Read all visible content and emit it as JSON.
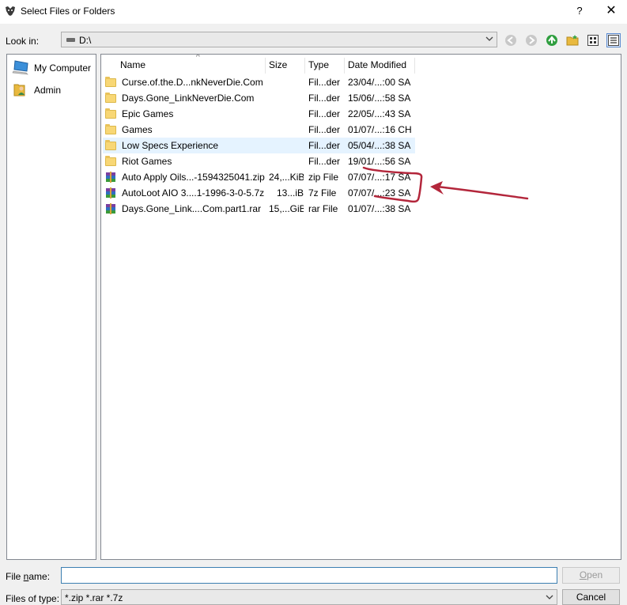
{
  "window": {
    "title": "Select Files or Folders",
    "help_glyph": "?",
    "close_glyph": "✕"
  },
  "lookin": {
    "label": "Look in:",
    "value": "D:\\"
  },
  "toolbar": [
    "back-icon",
    "forward-icon",
    "up-icon",
    "new-folder-icon",
    "list-view-icon",
    "details-view-icon"
  ],
  "places": [
    {
      "label": "My Computer",
      "icon": "computer-icon"
    },
    {
      "label": "Admin",
      "icon": "user-folder-icon"
    }
  ],
  "columns": {
    "name": "Name",
    "size": "Size",
    "type": "Type",
    "date": "Date Modified",
    "sort_indicator": "^"
  },
  "files": [
    {
      "name": "Curse.of.the.D...nkNeverDie.Com",
      "size": "",
      "type": "Fil...der",
      "date": "23/04/...:00 SA",
      "icon": "folder-icon"
    },
    {
      "name": "Days.Gone_LinkNeverDie.Com",
      "size": "",
      "type": "Fil...der",
      "date": "15/06/...:58 SA",
      "icon": "folder-icon"
    },
    {
      "name": "Epic Games",
      "size": "",
      "type": "Fil...der",
      "date": "22/05/...:43 SA",
      "icon": "folder-icon"
    },
    {
      "name": "Games",
      "size": "",
      "type": "Fil...der",
      "date": "01/07/...:16 CH",
      "icon": "folder-icon"
    },
    {
      "name": "Low Specs Experience",
      "size": "",
      "type": "Fil...der",
      "date": "05/04/...:38 SA",
      "icon": "folder-icon",
      "selected": true
    },
    {
      "name": "Riot Games",
      "size": "",
      "type": "Fil...der",
      "date": "19/01/...:56 SA",
      "icon": "folder-icon"
    },
    {
      "name": "Auto Apply Oils...-1594325041.zip",
      "size": "24,...KiB",
      "type": "zip File",
      "date": "07/07/...:17 SA",
      "icon": "archive-icon"
    },
    {
      "name": "AutoLoot AIO 3....1-1996-3-0-5.7z",
      "size": "13...iB",
      "type": "7z File",
      "date": "07/07/...:23 SA",
      "icon": "archive-icon"
    },
    {
      "name": "Days.Gone_Link....Com.part1.rar",
      "size": "15,...GiB",
      "type": "rar File",
      "date": "01/07/...:38 SA",
      "icon": "archive-icon"
    }
  ],
  "filename": {
    "label_pre": "File ",
    "label_mn": "n",
    "label_post": "ame:",
    "value": "",
    "open_mn": "O",
    "open_post": "pen"
  },
  "filetype": {
    "label": "Files of type:",
    "value": "*.zip *.rar *.7z",
    "cancel": "Cancel"
  },
  "colors": {
    "accent": "#3c7fb1",
    "selection": "#e5f3ff",
    "annotation": "#b3263b"
  }
}
